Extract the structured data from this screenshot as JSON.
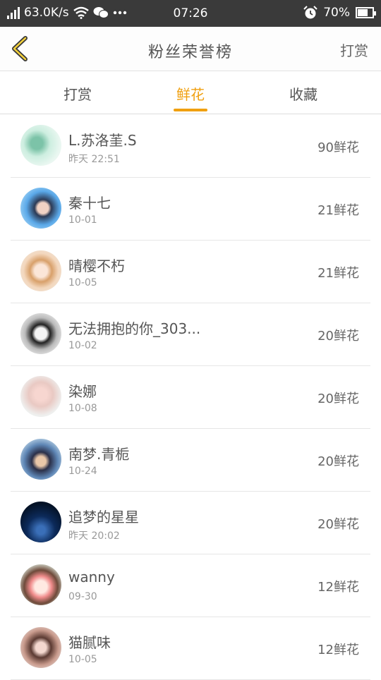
{
  "status": {
    "speed": "63.0K/s",
    "time": "07:26",
    "battery": "70%",
    "battery_level": 0.7,
    "icons": [
      "signal-icon",
      "wifi-icon",
      "wechat-icon",
      "more-icon",
      "alarm-icon",
      "battery-icon"
    ]
  },
  "header": {
    "title": "粉丝荣誉榜",
    "back_icon": "chevron-left-icon",
    "right_label": "打赏",
    "accent": "#f0a010"
  },
  "tabs": [
    {
      "label": "打赏"
    },
    {
      "label": "鲜花"
    },
    {
      "label": "收藏"
    }
  ],
  "rows": [
    {
      "name": "L.苏洛茥.S",
      "time": "昨天 22:51",
      "count": "90鲜花"
    },
    {
      "name": "秦十七",
      "time": "10-01",
      "count": "21鲜花"
    },
    {
      "name": "晴樱不朽",
      "time": "10-05",
      "count": "21鲜花"
    },
    {
      "name": "无法拥抱的你_303...",
      "time": "10-02",
      "count": "20鲜花"
    },
    {
      "name": "染娜",
      "time": "10-08",
      "count": "20鲜花"
    },
    {
      "name": "南梦.青栀",
      "time": "10-24",
      "count": "20鲜花"
    },
    {
      "name": "追梦的星星",
      "time": "昨天 20:02",
      "count": "20鲜花"
    },
    {
      "name": "wanny",
      "time": "09-30",
      "count": "12鲜花"
    },
    {
      "name": "猫腻味",
      "time": "10-05",
      "count": "12鲜花"
    }
  ]
}
